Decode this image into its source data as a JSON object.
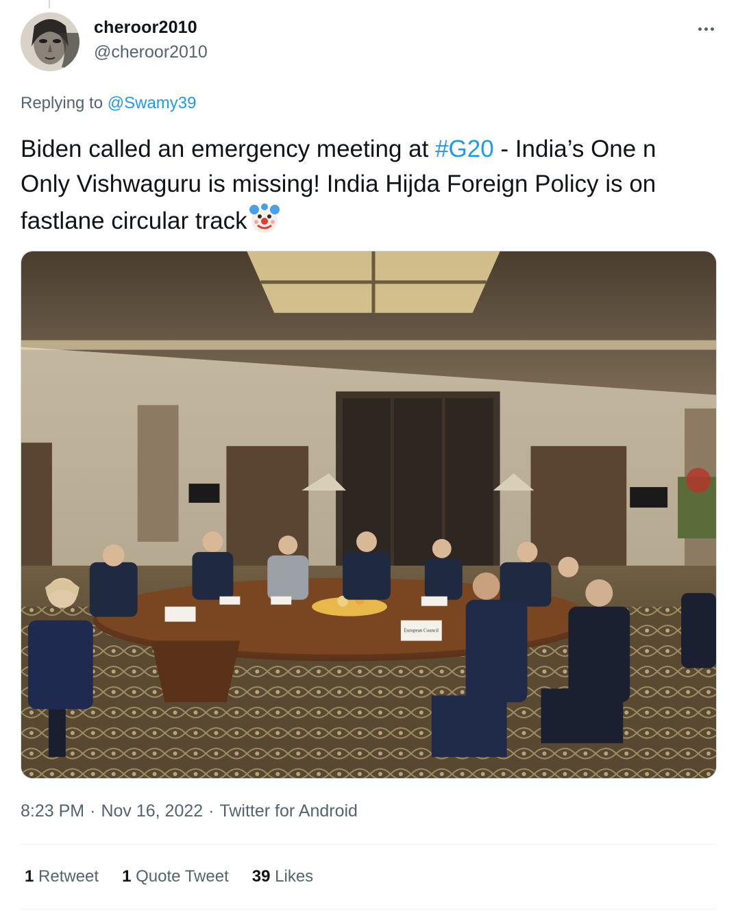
{
  "user": {
    "display_name": "cheroor2010",
    "handle": "@cheroor2010",
    "avatar_icon": "avatar-photo"
  },
  "reply": {
    "prefix": "Replying to ",
    "mention": "@Swamy39"
  },
  "tweet": {
    "text_part1": "Biden called an emergency meeting at ",
    "hashtag": "#G20",
    "text_part2": " - India’s One n Only Vishwaguru is missing! India Hijda Foreign Policy is on fastlane circular track",
    "emoji_icon": "clown-face-icon"
  },
  "media": {
    "icon": "photo-meeting-room",
    "placards": [
      "European Council"
    ]
  },
  "meta": {
    "time": "8:23 PM",
    "date": "Nov 16, 2022",
    "source": "Twitter for Android",
    "separator": "·"
  },
  "stats": {
    "retweets_count": "1",
    "retweets_label": "Retweet",
    "quotes_count": "1",
    "quotes_label": "Quote Tweet",
    "likes_count": "39",
    "likes_label": "Likes"
  },
  "colors": {
    "link": "#1d9bf0",
    "secondary_text": "#536471",
    "primary_text": "#0f1419"
  }
}
